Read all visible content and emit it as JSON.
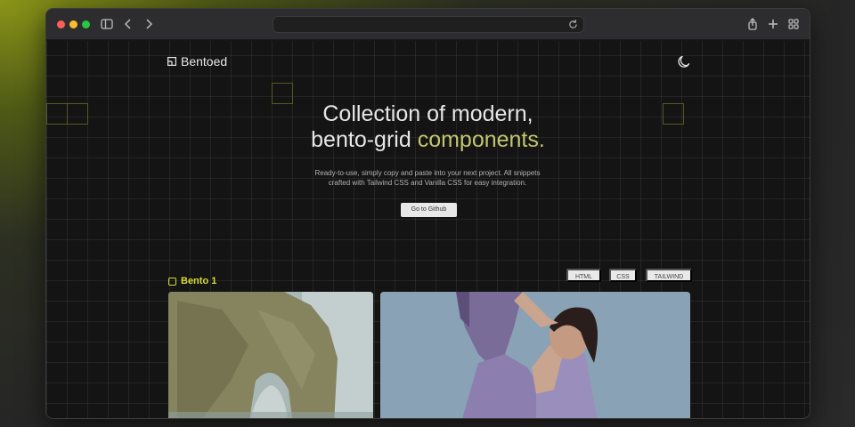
{
  "browser": {
    "url": "",
    "icons": [
      "sidebar-icon",
      "back-icon",
      "forward-icon",
      "reload-icon",
      "share-icon",
      "new-tab-icon",
      "tab-overview-icon"
    ]
  },
  "site": {
    "logo": "Bentoed"
  },
  "hero": {
    "title_line1": "Collection of modern,",
    "title_line2_plain": "bento-grid ",
    "title_line2_accent": "components.",
    "subtitle_line1": "Ready-to-use, simply copy and paste into your next project. All snippets",
    "subtitle_line2": "crafted with Tailwind CSS and Vanilla CSS for easy integration.",
    "cta": "Go to Github"
  },
  "section": {
    "title": "Bento 1",
    "tabs": [
      "HTML",
      "CSS",
      "TAILWIND"
    ]
  },
  "colors": {
    "accent": "#c2c56e",
    "section_accent": "#d6dd32",
    "background": "#141414"
  }
}
